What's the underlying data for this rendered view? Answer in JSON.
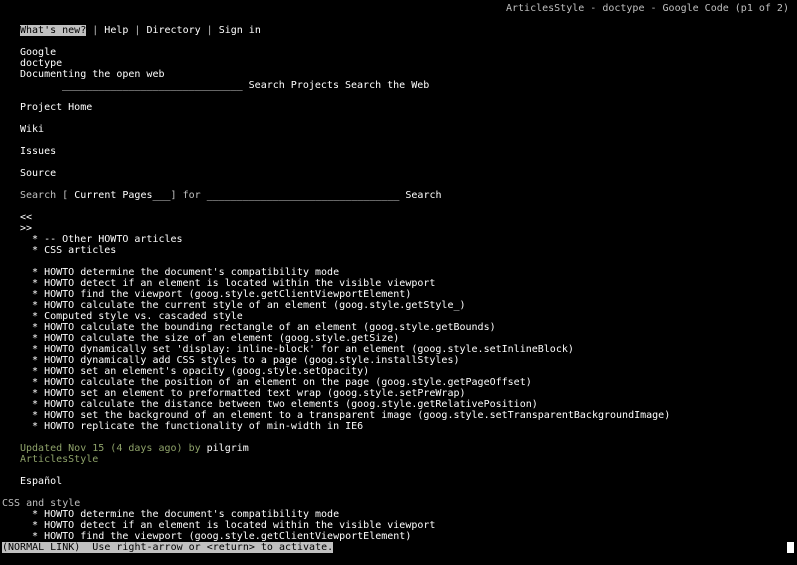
{
  "title_bar": "ArticlesStyle - doctype - Google Code (p1 of 2)",
  "top_nav": {
    "whats_new": "What's new?",
    "sep1": " | ",
    "help": "Help",
    "sep2": " | ",
    "directory": "Directory",
    "sep3": " | ",
    "sign_in": "Sign in"
  },
  "header": {
    "google": "Google",
    "doctype": "doctype",
    "tagline": "Documenting the open web"
  },
  "search_bar": {
    "input": "______________________________",
    "search_projects": "Search Projects",
    "search_web": "Search the Web"
  },
  "project_nav": {
    "project_home": "Project Home",
    "wiki": "Wiki",
    "issues": "Issues",
    "source": "Source"
  },
  "page_search": {
    "label": "Search",
    "bracket_open": "[",
    "select_value": "Current Pages___",
    "bracket_close": "]",
    "for": "for",
    "input": "________________________________",
    "button": "Search"
  },
  "prev_link": "<<",
  "next_link": ">>",
  "toc": {
    "other_howto": "  * -- Other HOWTO articles",
    "css_articles": "  * CSS articles"
  },
  "articles": [
    "  * HOWTO determine the document's compatibility mode",
    "  * HOWTO detect if an element is located within the visible viewport",
    "  * HOWTO find the viewport (goog.style.getClientViewportElement)",
    "  * HOWTO calculate the current style of an element (goog.style.getStyle_)",
    "  * Computed style vs. cascaded style",
    "  * HOWTO calculate the bounding rectangle of an element (goog.style.getBounds)",
    "  * HOWTO calculate the size of an element (goog.style.getSize)",
    "  * HOWTO dynamically set 'display: inline-block' for an element (goog.style.setInlineBlock)",
    "  * HOWTO dynamically add CSS styles to a page (goog.style.installStyles)",
    "  * HOWTO set an element's opacity (goog.style.setOpacity)",
    "  * HOWTO calculate the position of an element on the page (goog.style.getPageOffset)",
    "  * HOWTO set an element to preformatted text wrap (goog.style.setPreWrap)",
    "  * HOWTO calculate the distance between two elements (goog.style.getRelativePosition)",
    "  * HOWTO set the background of an element to a transparent image (goog.style.setTransparentBackgroundImage)",
    "  * HOWTO replicate the functionality of min-width in IE6"
  ],
  "updated": {
    "text": "Updated Nov 15 (4 days ago) by ",
    "author": "pilgrim"
  },
  "page_name": "ArticlesStyle",
  "espanol": "Español",
  "section_heading": "CSS and style",
  "section_articles": [
    "  * HOWTO determine the document's compatibility mode",
    "  * HOWTO detect if an element is located within the visible viewport",
    "  * HOWTO find the viewport (goog.style.getClientViewportElement)"
  ],
  "status_bar": "(NORMAL LINK)  Use right-arrow or <return> to activate."
}
